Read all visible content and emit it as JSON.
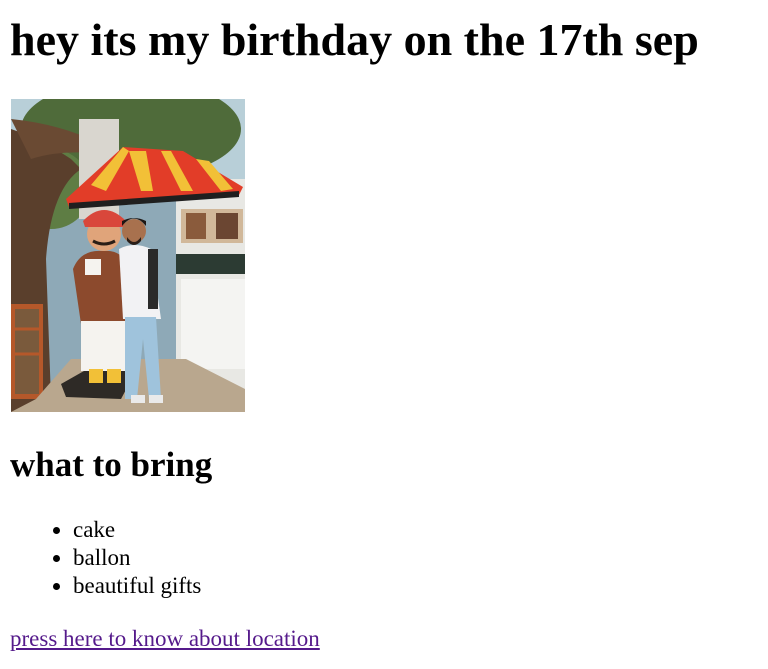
{
  "page": {
    "heading": "hey its my birthday on the 17th sep",
    "subheading": "what to bring",
    "items": [
      "cake",
      "ballon",
      "beautiful gifts"
    ],
    "link_text": "press here to know about location"
  },
  "colors": {
    "text": "#000000",
    "visited_link": "#551a8b",
    "background": "#ffffff"
  }
}
